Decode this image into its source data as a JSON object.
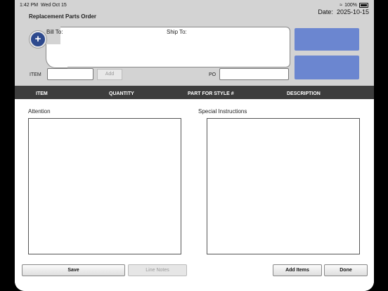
{
  "status": {
    "time": "1:42 PM",
    "day": "Wed Oct 15",
    "battery": "100%"
  },
  "form": {
    "title": "Replacement Parts Order",
    "date_label": "Date:",
    "date_value": "2025-10-15",
    "bill_to": "Bill To:",
    "ship_to": "Ship To:",
    "item_label": "ITEM",
    "add_label": "Add",
    "po_label": "PO"
  },
  "table": {
    "columns": [
      "ITEM",
      "QUANTITY",
      "PART FOR STYLE #",
      "DESCRIPTION"
    ]
  },
  "notes": {
    "attention": "Attention",
    "special": "Special Instructions"
  },
  "buttons": {
    "save": "Save",
    "line_notes": "Line Notes",
    "add_items": "Add Items",
    "done": "Done"
  },
  "colors": {
    "accent_blue": "#6b86d0",
    "header_bar": "#3d3d3d",
    "plus_button": "#2e4a8e"
  }
}
